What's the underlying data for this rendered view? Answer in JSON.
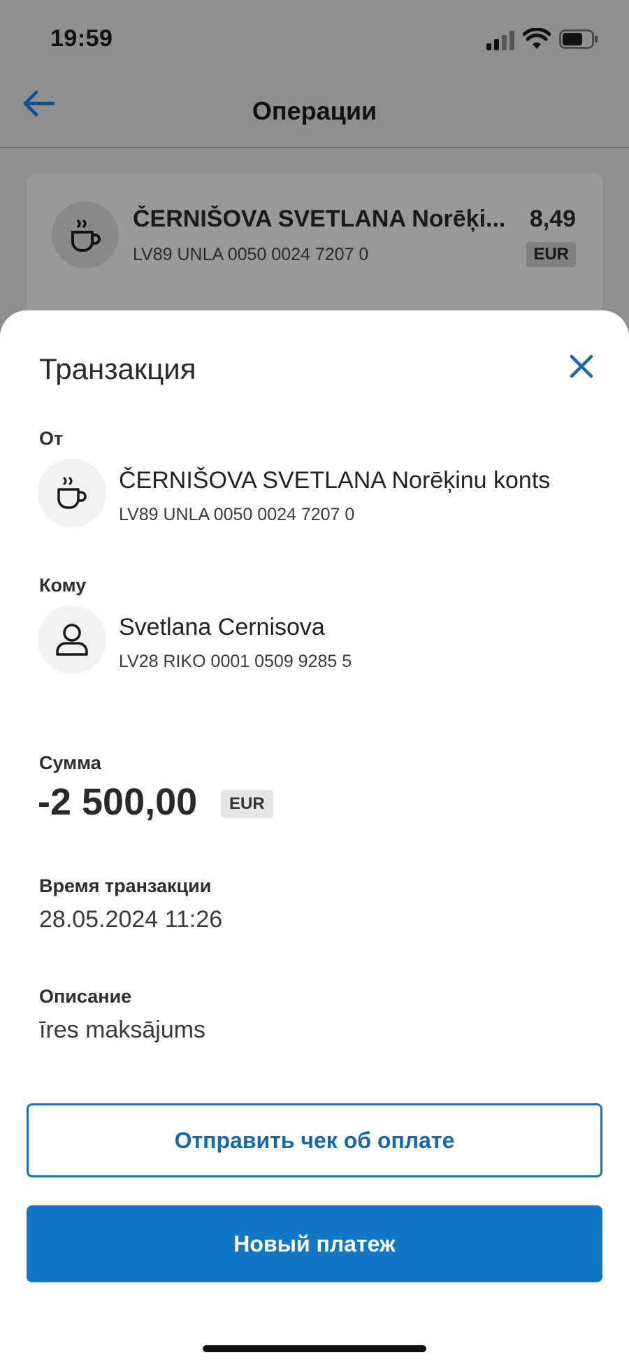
{
  "status_bar": {
    "time": "19:59"
  },
  "nav": {
    "title": "Операции"
  },
  "background_item": {
    "name": "ČERNIŠOVA SVETLANA Norēķi...",
    "iban": "LV89 UNLA 0050 0024 7207 0",
    "amount": "8,49",
    "currency": "EUR",
    "icon": "coffee-cup-icon"
  },
  "sheet": {
    "title": "Транзакция",
    "from": {
      "label": "От",
      "name": "ČERNIŠOVA SVETLANA Norēķinu konts",
      "iban": "LV89 UNLA 0050 0024 7207 0",
      "icon": "coffee-cup-icon"
    },
    "to": {
      "label": "Кому",
      "name": "Svetlana Cernisova",
      "iban": "LV28 RIKO 0001 0509 9285 5",
      "icon": "person-icon"
    },
    "amount": {
      "label": "Сумма",
      "value": "-2 500,00",
      "currency": "EUR"
    },
    "time": {
      "label": "Время транзакции",
      "value": "28.05.2024 11:26"
    },
    "description": {
      "label": "Описание",
      "value": "īres maksājums"
    },
    "buttons": {
      "send_receipt": "Отправить чек об оплате",
      "new_payment": "Новый платеж"
    }
  },
  "colors": {
    "accent": "#1175c8",
    "overlay": "#8f8f8f",
    "sheet_bg": "#ffffff"
  }
}
